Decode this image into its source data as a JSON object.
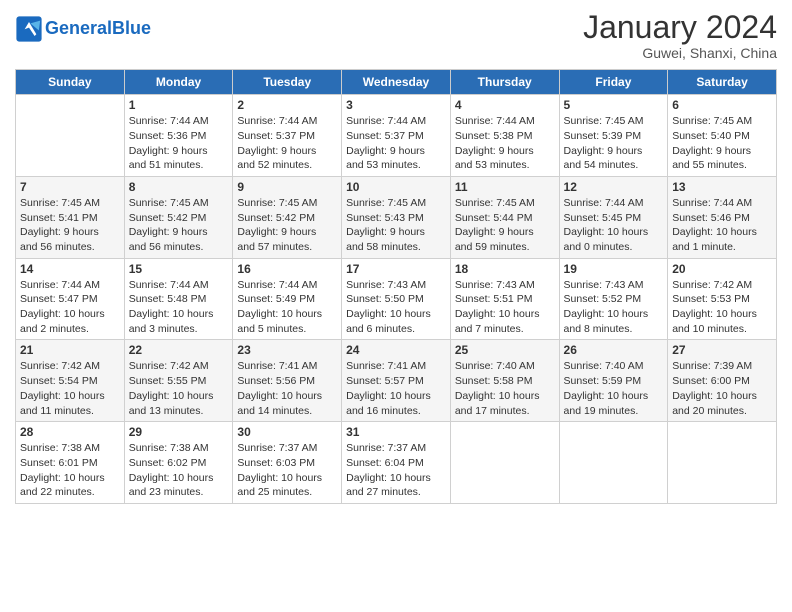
{
  "header": {
    "logo_text_general": "General",
    "logo_text_blue": "Blue",
    "month_title": "January 2024",
    "location": "Guwei, Shanxi, China"
  },
  "calendar": {
    "days_of_week": [
      "Sunday",
      "Monday",
      "Tuesday",
      "Wednesday",
      "Thursday",
      "Friday",
      "Saturday"
    ],
    "weeks": [
      [
        {
          "day": "",
          "info": ""
        },
        {
          "day": "1",
          "info": "Sunrise: 7:44 AM\nSunset: 5:36 PM\nDaylight: 9 hours\nand 51 minutes."
        },
        {
          "day": "2",
          "info": "Sunrise: 7:44 AM\nSunset: 5:37 PM\nDaylight: 9 hours\nand 52 minutes."
        },
        {
          "day": "3",
          "info": "Sunrise: 7:44 AM\nSunset: 5:37 PM\nDaylight: 9 hours\nand 53 minutes."
        },
        {
          "day": "4",
          "info": "Sunrise: 7:44 AM\nSunset: 5:38 PM\nDaylight: 9 hours\nand 53 minutes."
        },
        {
          "day": "5",
          "info": "Sunrise: 7:45 AM\nSunset: 5:39 PM\nDaylight: 9 hours\nand 54 minutes."
        },
        {
          "day": "6",
          "info": "Sunrise: 7:45 AM\nSunset: 5:40 PM\nDaylight: 9 hours\nand 55 minutes."
        }
      ],
      [
        {
          "day": "7",
          "info": "Sunrise: 7:45 AM\nSunset: 5:41 PM\nDaylight: 9 hours\nand 56 minutes."
        },
        {
          "day": "8",
          "info": "Sunrise: 7:45 AM\nSunset: 5:42 PM\nDaylight: 9 hours\nand 56 minutes."
        },
        {
          "day": "9",
          "info": "Sunrise: 7:45 AM\nSunset: 5:42 PM\nDaylight: 9 hours\nand 57 minutes."
        },
        {
          "day": "10",
          "info": "Sunrise: 7:45 AM\nSunset: 5:43 PM\nDaylight: 9 hours\nand 58 minutes."
        },
        {
          "day": "11",
          "info": "Sunrise: 7:45 AM\nSunset: 5:44 PM\nDaylight: 9 hours\nand 59 minutes."
        },
        {
          "day": "12",
          "info": "Sunrise: 7:44 AM\nSunset: 5:45 PM\nDaylight: 10 hours\nand 0 minutes."
        },
        {
          "day": "13",
          "info": "Sunrise: 7:44 AM\nSunset: 5:46 PM\nDaylight: 10 hours\nand 1 minute."
        }
      ],
      [
        {
          "day": "14",
          "info": "Sunrise: 7:44 AM\nSunset: 5:47 PM\nDaylight: 10 hours\nand 2 minutes."
        },
        {
          "day": "15",
          "info": "Sunrise: 7:44 AM\nSunset: 5:48 PM\nDaylight: 10 hours\nand 3 minutes."
        },
        {
          "day": "16",
          "info": "Sunrise: 7:44 AM\nSunset: 5:49 PM\nDaylight: 10 hours\nand 5 minutes."
        },
        {
          "day": "17",
          "info": "Sunrise: 7:43 AM\nSunset: 5:50 PM\nDaylight: 10 hours\nand 6 minutes."
        },
        {
          "day": "18",
          "info": "Sunrise: 7:43 AM\nSunset: 5:51 PM\nDaylight: 10 hours\nand 7 minutes."
        },
        {
          "day": "19",
          "info": "Sunrise: 7:43 AM\nSunset: 5:52 PM\nDaylight: 10 hours\nand 8 minutes."
        },
        {
          "day": "20",
          "info": "Sunrise: 7:42 AM\nSunset: 5:53 PM\nDaylight: 10 hours\nand 10 minutes."
        }
      ],
      [
        {
          "day": "21",
          "info": "Sunrise: 7:42 AM\nSunset: 5:54 PM\nDaylight: 10 hours\nand 11 minutes."
        },
        {
          "day": "22",
          "info": "Sunrise: 7:42 AM\nSunset: 5:55 PM\nDaylight: 10 hours\nand 13 minutes."
        },
        {
          "day": "23",
          "info": "Sunrise: 7:41 AM\nSunset: 5:56 PM\nDaylight: 10 hours\nand 14 minutes."
        },
        {
          "day": "24",
          "info": "Sunrise: 7:41 AM\nSunset: 5:57 PM\nDaylight: 10 hours\nand 16 minutes."
        },
        {
          "day": "25",
          "info": "Sunrise: 7:40 AM\nSunset: 5:58 PM\nDaylight: 10 hours\nand 17 minutes."
        },
        {
          "day": "26",
          "info": "Sunrise: 7:40 AM\nSunset: 5:59 PM\nDaylight: 10 hours\nand 19 minutes."
        },
        {
          "day": "27",
          "info": "Sunrise: 7:39 AM\nSunset: 6:00 PM\nDaylight: 10 hours\nand 20 minutes."
        }
      ],
      [
        {
          "day": "28",
          "info": "Sunrise: 7:38 AM\nSunset: 6:01 PM\nDaylight: 10 hours\nand 22 minutes."
        },
        {
          "day": "29",
          "info": "Sunrise: 7:38 AM\nSunset: 6:02 PM\nDaylight: 10 hours\nand 23 minutes."
        },
        {
          "day": "30",
          "info": "Sunrise: 7:37 AM\nSunset: 6:03 PM\nDaylight: 10 hours\nand 25 minutes."
        },
        {
          "day": "31",
          "info": "Sunrise: 7:37 AM\nSunset: 6:04 PM\nDaylight: 10 hours\nand 27 minutes."
        },
        {
          "day": "",
          "info": ""
        },
        {
          "day": "",
          "info": ""
        },
        {
          "day": "",
          "info": ""
        }
      ]
    ]
  }
}
